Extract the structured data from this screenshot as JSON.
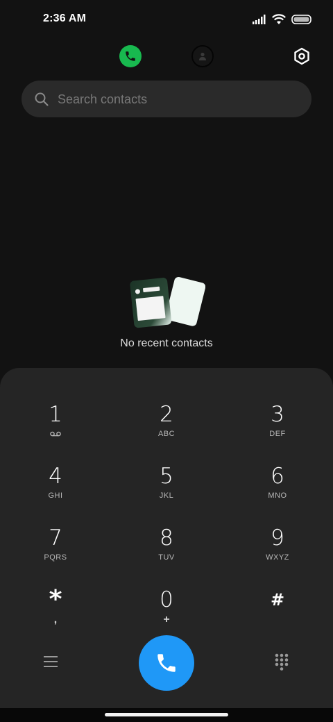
{
  "status_bar": {
    "time": "2:36 AM"
  },
  "icons": {
    "signal": "signal-icon",
    "wifi": "wifi-icon",
    "battery": "battery-icon",
    "phone_tab": "phone-icon",
    "contacts_tab": "contacts-icon",
    "settings": "settings-icon",
    "search": "search-icon",
    "menu": "menu-icon",
    "call": "call-icon",
    "keypad": "keypad-icon"
  },
  "colors": {
    "background": "#121212",
    "accent_green": "#18b94f",
    "call_blue": "#1f98f7",
    "dialpad_bg": "#252525"
  },
  "search": {
    "placeholder": "Search contacts",
    "value": ""
  },
  "empty_state": {
    "message": "No recent contacts"
  },
  "dialpad": {
    "keys": [
      {
        "digit": "1",
        "letters": "",
        "sub_icon": "voicemail-icon"
      },
      {
        "digit": "2",
        "letters": "ABC"
      },
      {
        "digit": "3",
        "letters": "DEF"
      },
      {
        "digit": "4",
        "letters": "GHI"
      },
      {
        "digit": "5",
        "letters": "JKL"
      },
      {
        "digit": "6",
        "letters": "MNO"
      },
      {
        "digit": "7",
        "letters": "PQRS"
      },
      {
        "digit": "8",
        "letters": "TUV"
      },
      {
        "digit": "9",
        "letters": "WXYZ"
      },
      {
        "digit": "*",
        "letters": ","
      },
      {
        "digit": "0",
        "letters": "+"
      },
      {
        "digit": "#",
        "letters": ""
      }
    ]
  }
}
